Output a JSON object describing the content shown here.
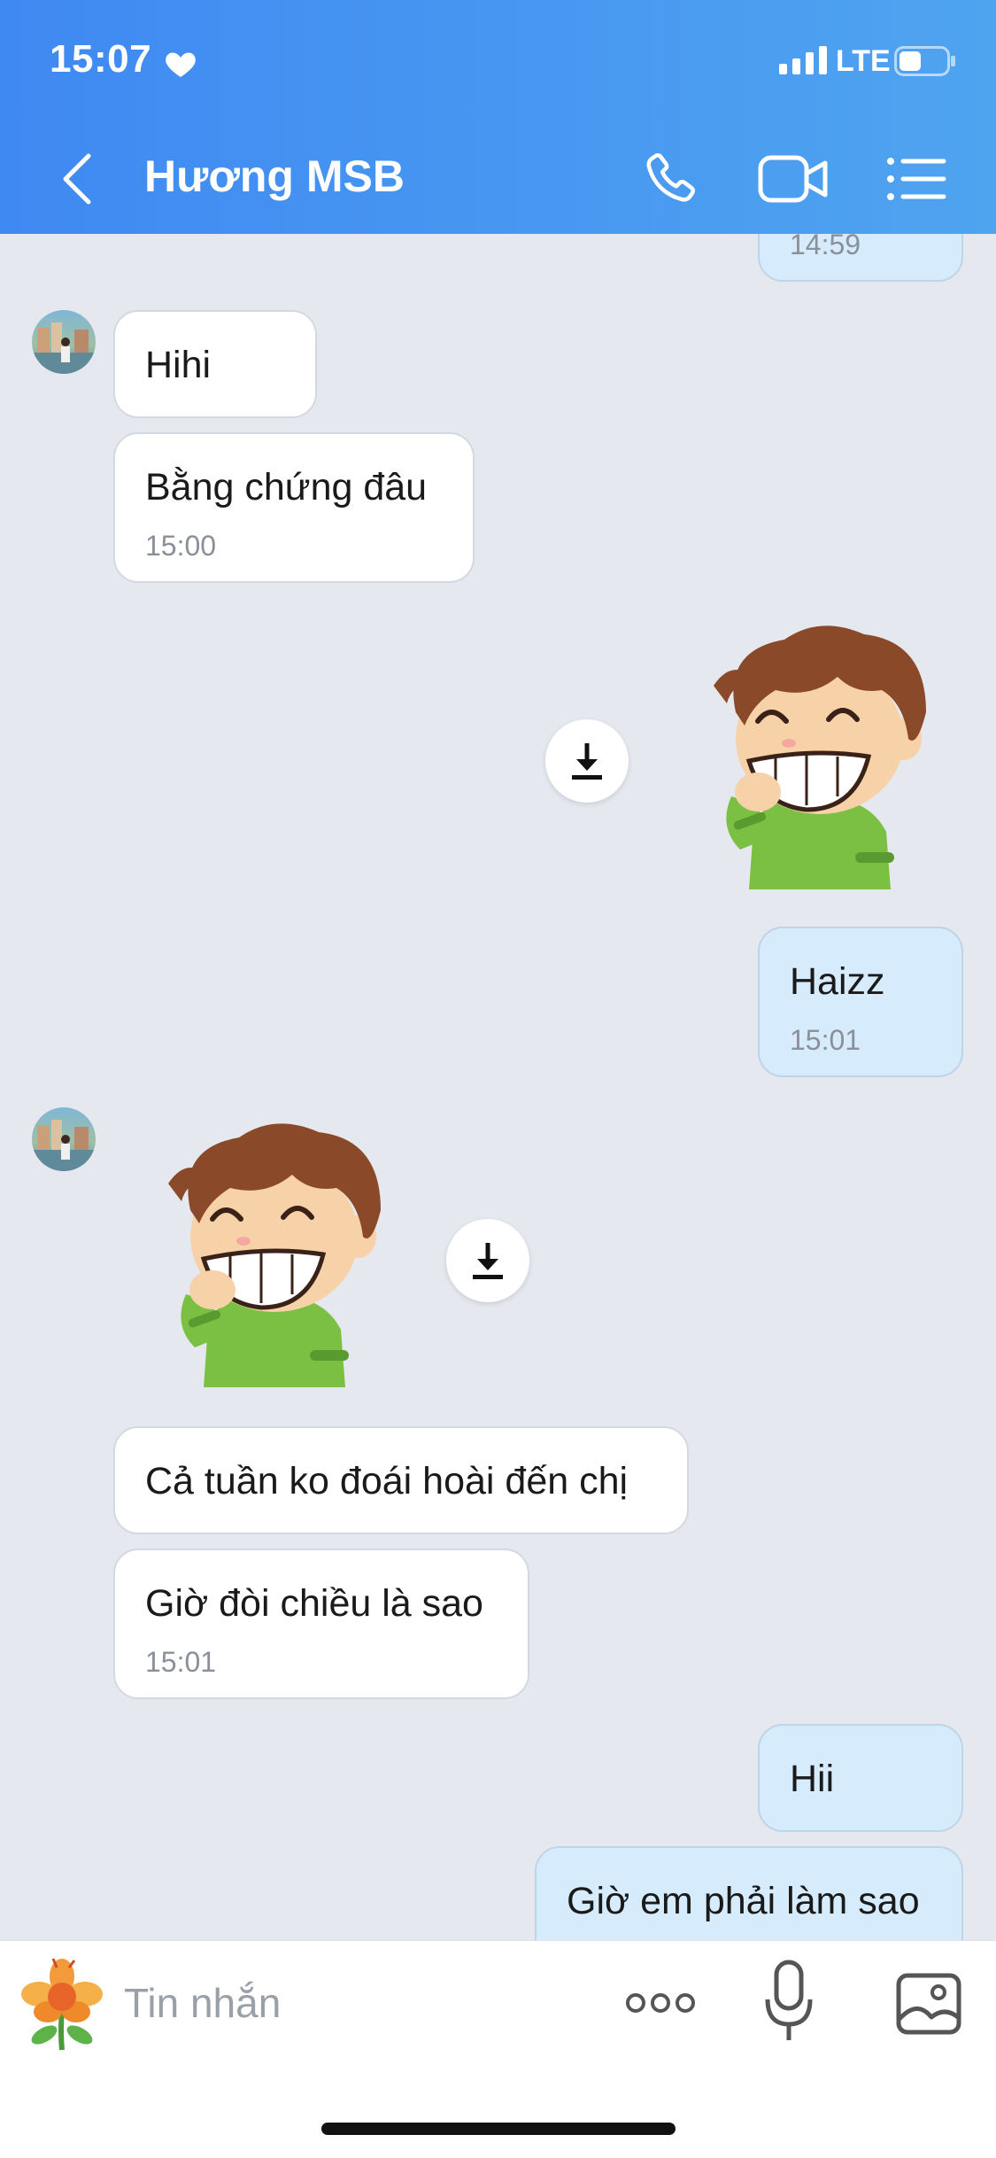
{
  "status_bar": {
    "time": "15:07",
    "network": "LTE"
  },
  "header": {
    "contact_name": "Hương MSB"
  },
  "messages": [
    {
      "kind": "text",
      "direction": "out",
      "time": "14:59"
    },
    {
      "kind": "text",
      "direction": "in",
      "text": "Hihi"
    },
    {
      "kind": "text",
      "direction": "in",
      "text": "Bằng chứng đâu",
      "time": "15:00"
    },
    {
      "kind": "sticker",
      "direction": "out"
    },
    {
      "kind": "text",
      "direction": "out",
      "text": "Haizz",
      "time": "15:01"
    },
    {
      "kind": "sticker",
      "direction": "in"
    },
    {
      "kind": "text",
      "direction": "in",
      "text": "Cả tuần ko đoái hoài đến chị"
    },
    {
      "kind": "text",
      "direction": "in",
      "text": "Giờ đòi chiều là sao",
      "time": "15:01"
    },
    {
      "kind": "text",
      "direction": "out",
      "text": "Hii"
    },
    {
      "kind": "text",
      "direction": "out",
      "text": "Giờ em phải làm sao"
    }
  ],
  "composer": {
    "placeholder": "Tin nhắn"
  },
  "icons": {
    "status": [
      "heart-icon",
      "signal-icon",
      "battery-icon"
    ],
    "header": [
      "back-icon",
      "phone-icon",
      "video-call-icon",
      "list-menu-icon"
    ],
    "chat": [
      "download-icon"
    ],
    "composer": [
      "sticker-flower-icon",
      "more-dots-icon",
      "microphone-icon",
      "image-icon"
    ]
  },
  "colors": {
    "header_start": "#3f89f2",
    "header_end": "#4fa4f0",
    "chat_background": "#e5e8ef",
    "incoming_bubble": "#ffffff",
    "outgoing_bubble": "#d6ecfc"
  }
}
